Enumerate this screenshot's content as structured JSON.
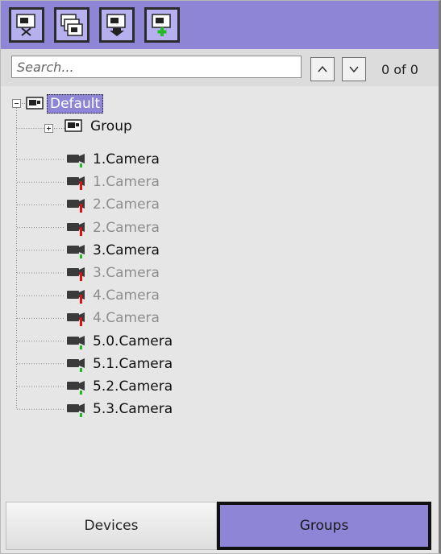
{
  "toolbar": {
    "buttons": [
      {
        "name": "remove-from-group-button",
        "icon": "camera-scissors-icon"
      },
      {
        "name": "copy-button",
        "icon": "camera-stack-icon"
      },
      {
        "name": "move-down-button",
        "icon": "camera-arrow-down-icon"
      },
      {
        "name": "add-button",
        "icon": "camera-plus-icon"
      }
    ]
  },
  "search": {
    "placeholder": "Search...",
    "value": "",
    "count_text": "0 of 0"
  },
  "tree": {
    "root": {
      "label": "Default",
      "expanded": true,
      "selected": true
    },
    "group": {
      "label": "Group",
      "expanded": false
    },
    "cameras": [
      {
        "label": "1.Camera",
        "state": "active"
      },
      {
        "label": "1.Camera",
        "state": "inactive"
      },
      {
        "label": "2.Camera",
        "state": "inactive"
      },
      {
        "label": "2.Camera",
        "state": "inactive"
      },
      {
        "label": "3.Camera",
        "state": "active"
      },
      {
        "label": "3.Camera",
        "state": "inactive"
      },
      {
        "label": "4.Camera",
        "state": "inactive"
      },
      {
        "label": "4.Camera",
        "state": "inactive"
      },
      {
        "label": "5.0.Camera",
        "state": "active"
      },
      {
        "label": "5.1.Camera",
        "state": "active"
      },
      {
        "label": "5.2.Camera",
        "state": "active"
      },
      {
        "label": "5.3.Camera",
        "state": "active"
      }
    ]
  },
  "tabs": {
    "devices_label": "Devices",
    "groups_label": "Groups",
    "active": "Groups"
  },
  "colors": {
    "accent": "#8f85d6",
    "status_active": "#22bb22",
    "status_inactive": "#dd1111"
  }
}
